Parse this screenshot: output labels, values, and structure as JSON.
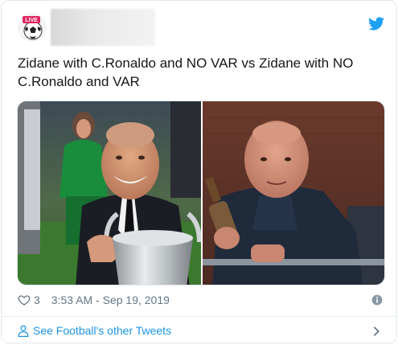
{
  "tweet": {
    "avatar_badge": "LIVE",
    "text": "Zidane with C.Ronaldo and NO VAR vs Zidane with NO C.Ronaldo and VAR",
    "likes": "3",
    "timestamp": "3:53 AM - Sep 19, 2019"
  },
  "footer": {
    "link_label": "See Football's other Tweets"
  },
  "icons": {
    "brand": "twitter-bird-icon",
    "like": "heart-icon",
    "info": "info-icon",
    "profile": "person-icon",
    "more": "chevron-right-icon"
  },
  "colors": {
    "twitter_blue": "#1da1f2",
    "link_blue": "#1b95e0",
    "meta_gray": "#657786",
    "text": "#14171a",
    "badge_red": "#e0245e"
  }
}
